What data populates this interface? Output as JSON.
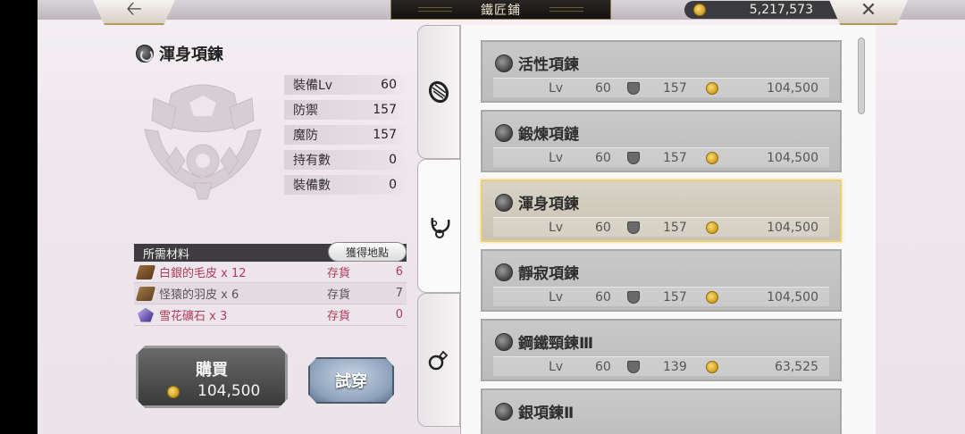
{
  "header": {
    "back_icon": "back-arrow-icon",
    "title": "鐵匠鋪",
    "gold": "5,217,573",
    "close_icon": "close-icon"
  },
  "detail": {
    "item_name": "渾身項鍊",
    "stats": [
      {
        "label": "裝備Lv",
        "value": "60"
      },
      {
        "label": "防禦",
        "value": "157"
      },
      {
        "label": "魔防",
        "value": "157"
      },
      {
        "label": "持有數",
        "value": "0"
      },
      {
        "label": "裝備數",
        "value": "0"
      }
    ]
  },
  "materials": {
    "header": "所需材料",
    "source_button": "獲得地點",
    "items": [
      {
        "name": "白銀的毛皮 x 12",
        "stock_label": "存貨",
        "count": "6",
        "icon": "fur-icon"
      },
      {
        "name": "怪猿的羽皮 x 6",
        "stock_label": "存貨",
        "count": "7",
        "icon": "feather-icon"
      },
      {
        "name": "雪花礦石 x 3",
        "stock_label": "存貨",
        "count": "0",
        "icon": "ore-icon"
      }
    ]
  },
  "actions": {
    "buy_label": "購買",
    "buy_price": "104,500",
    "try_on_label": "試穿"
  },
  "tabs": [
    {
      "name": "bracelet",
      "icon": "bracelet-icon"
    },
    {
      "name": "necklace",
      "icon": "necklace-icon"
    },
    {
      "name": "ring",
      "icon": "ring-icon"
    }
  ],
  "list": [
    {
      "name": "活性項鍊",
      "lv_label": "Lv",
      "lv": "60",
      "def": "157",
      "price": "104,500"
    },
    {
      "name": "鍛煉項鏈",
      "lv_label": "Lv",
      "lv": "60",
      "def": "157",
      "price": "104,500"
    },
    {
      "name": "渾身項鍊",
      "lv_label": "Lv",
      "lv": "60",
      "def": "157",
      "price": "104,500"
    },
    {
      "name": "靜寂項鍊",
      "lv_label": "Lv",
      "lv": "60",
      "def": "157",
      "price": "104,500"
    },
    {
      "name": "鋼鐵頸鍊Ⅲ",
      "lv_label": "Lv",
      "lv": "60",
      "def": "139",
      "price": "63,525"
    },
    {
      "name": "銀項鍊Ⅱ",
      "lv_label": "",
      "lv": "",
      "def": "",
      "price": ""
    }
  ],
  "colors": {
    "selected_border": "#e8cf7a",
    "shortage_text": "#b03c5a",
    "coin": "#d6a526"
  }
}
